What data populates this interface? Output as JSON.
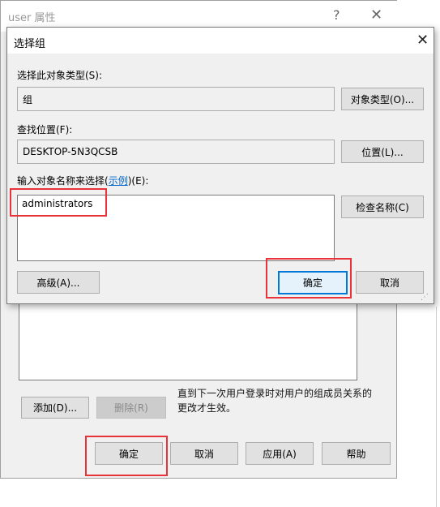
{
  "bg_window": {
    "title": "user 属性",
    "help_glyph": "?",
    "close_glyph": "✕",
    "note": "直到下一次用户登录时对用户的组成员关系的更改才生效。",
    "add_label": "添加(D)...",
    "remove_label": "删除(R)",
    "ok_label": "确定",
    "cancel_label": "取消",
    "apply_label": "应用(A)",
    "help_label": "帮助"
  },
  "dialog": {
    "title": "选择组",
    "close_glyph": "✕",
    "object_type_label": "选择此对象类型(S):",
    "object_type_value": "组",
    "object_type_button": "对象类型(O)...",
    "location_label": "查找位置(F):",
    "location_value": "DESKTOP-5N3QCSB",
    "location_button": "位置(L)...",
    "names_label_prefix": "输入对象名称来选择(",
    "names_label_link": "示例",
    "names_label_suffix": ")(E):",
    "names_value": "administrators",
    "check_names_button": "检查名称(C)",
    "advanced_button": "高级(A)...",
    "ok_button": "确定",
    "cancel_button": "取消",
    "grip_glyph": "⋰"
  },
  "colors": {
    "highlight_red": "#e8333a",
    "focus_blue": "#0078d7",
    "link_blue": "#0066cc"
  }
}
